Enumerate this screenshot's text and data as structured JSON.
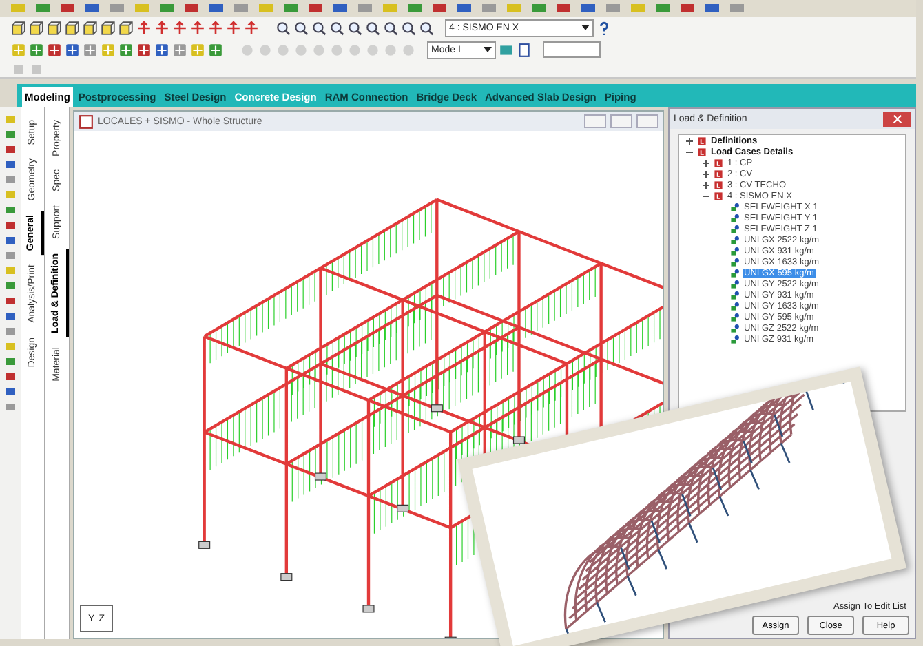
{
  "toolbar": {
    "load_case_dropdown": {
      "value": "4 : SISMO EN X"
    },
    "mode_dropdown": {
      "value": "Mode I"
    }
  },
  "tabs": [
    {
      "label": "Modeling",
      "selected": true,
      "highlight": false
    },
    {
      "label": "Postprocessing",
      "selected": false,
      "highlight": false
    },
    {
      "label": "Steel Design",
      "selected": false,
      "highlight": false
    },
    {
      "label": "Concrete Design",
      "selected": false,
      "highlight": true
    },
    {
      "label": "RAM Connection",
      "selected": false,
      "highlight": false
    },
    {
      "label": "Bridge Deck",
      "selected": false,
      "highlight": false
    },
    {
      "label": "Advanced Slab Design",
      "selected": false,
      "highlight": false
    },
    {
      "label": "Piping",
      "selected": false,
      "highlight": false
    }
  ],
  "side_tabs_outer": [
    {
      "label": "Setup",
      "selected": false
    },
    {
      "label": "Geometry",
      "selected": false
    },
    {
      "label": "General",
      "selected": true
    },
    {
      "label": "Analysis/Print",
      "selected": false
    },
    {
      "label": "Design",
      "selected": false
    }
  ],
  "side_tabs_inner": [
    {
      "label": "Property",
      "selected": false
    },
    {
      "label": "Spec",
      "selected": false
    },
    {
      "label": "Support",
      "selected": false
    },
    {
      "label": "Load & Definition",
      "selected": true
    },
    {
      "label": "Material",
      "selected": false
    }
  ],
  "viewport": {
    "title": "LOCALES + SISMO - Whole Structure",
    "axis_labels": [
      "Y",
      "Z"
    ]
  },
  "dialog": {
    "title": "Load & Definition",
    "tree": [
      {
        "label": "Definitions",
        "kind": "group",
        "expanded": false,
        "selected": false
      },
      {
        "label": "Load Cases Details",
        "kind": "group",
        "expanded": true,
        "selected": false,
        "children": [
          {
            "label": "1 : CP",
            "kind": "case",
            "expanded": false,
            "selected": false
          },
          {
            "label": "2 : CV",
            "kind": "case",
            "expanded": false,
            "selected": false
          },
          {
            "label": "3 : CV TECHO",
            "kind": "case",
            "expanded": false,
            "selected": false
          },
          {
            "label": "4 : SISMO EN X",
            "kind": "case",
            "expanded": true,
            "selected": false,
            "children": [
              {
                "label": "SELFWEIGHT X 1",
                "kind": "load",
                "selected": false
              },
              {
                "label": "SELFWEIGHT Y 1",
                "kind": "load",
                "selected": false
              },
              {
                "label": "SELFWEIGHT Z 1",
                "kind": "load",
                "selected": false
              },
              {
                "label": "UNI GX 2522 kg/m",
                "kind": "load",
                "selected": false
              },
              {
                "label": "UNI GX 931 kg/m",
                "kind": "load",
                "selected": false
              },
              {
                "label": "UNI GX 1633 kg/m",
                "kind": "load",
                "selected": false
              },
              {
                "label": "UNI GX 595 kg/m",
                "kind": "load",
                "selected": true
              },
              {
                "label": "UNI GY 2522 kg/m",
                "kind": "load",
                "selected": false
              },
              {
                "label": "UNI GY 931 kg/m",
                "kind": "load",
                "selected": false
              },
              {
                "label": "UNI GY 1633 kg/m",
                "kind": "load",
                "selected": false
              },
              {
                "label": "UNI GY 595 kg/m",
                "kind": "load",
                "selected": false
              },
              {
                "label": "UNI GZ 2522 kg/m",
                "kind": "load",
                "selected": false
              },
              {
                "label": "UNI GZ 931 kg/m",
                "kind": "load",
                "selected": false
              }
            ]
          }
        ]
      }
    ],
    "assign_option": "Assign To Edit List",
    "buttons": [
      "Assign",
      "Close",
      "Help"
    ]
  }
}
